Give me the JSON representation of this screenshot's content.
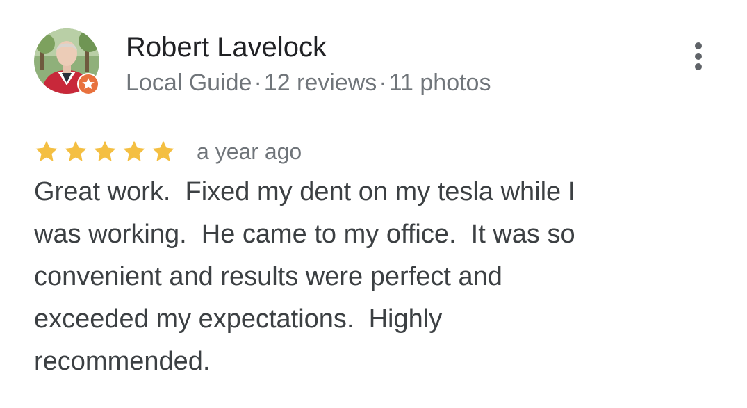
{
  "reviewer": {
    "name": "Robert Lavelock",
    "badge": "Local Guide",
    "separator": "·",
    "reviews": "12 reviews",
    "photos": "11 photos"
  },
  "review": {
    "rating": 5,
    "max_rating": 5,
    "time": "a year ago",
    "text_lines": [
      "Great work.  Fixed my dent on my tesla while I",
      "was working.  He came to my office.  It was so",
      "convenient and results were perfect and",
      "exceeded my expectations.  Highly",
      "recommended."
    ]
  },
  "colors": {
    "star": "#f4bf42",
    "badge": "#e8713d",
    "name": "#202124",
    "secondary": "#70757a",
    "body": "#3c4043",
    "menu": "#5f6368"
  },
  "icons": {
    "menu": "more-vert-icon",
    "badge": "local-guide-badge-icon",
    "star": "star-icon"
  }
}
